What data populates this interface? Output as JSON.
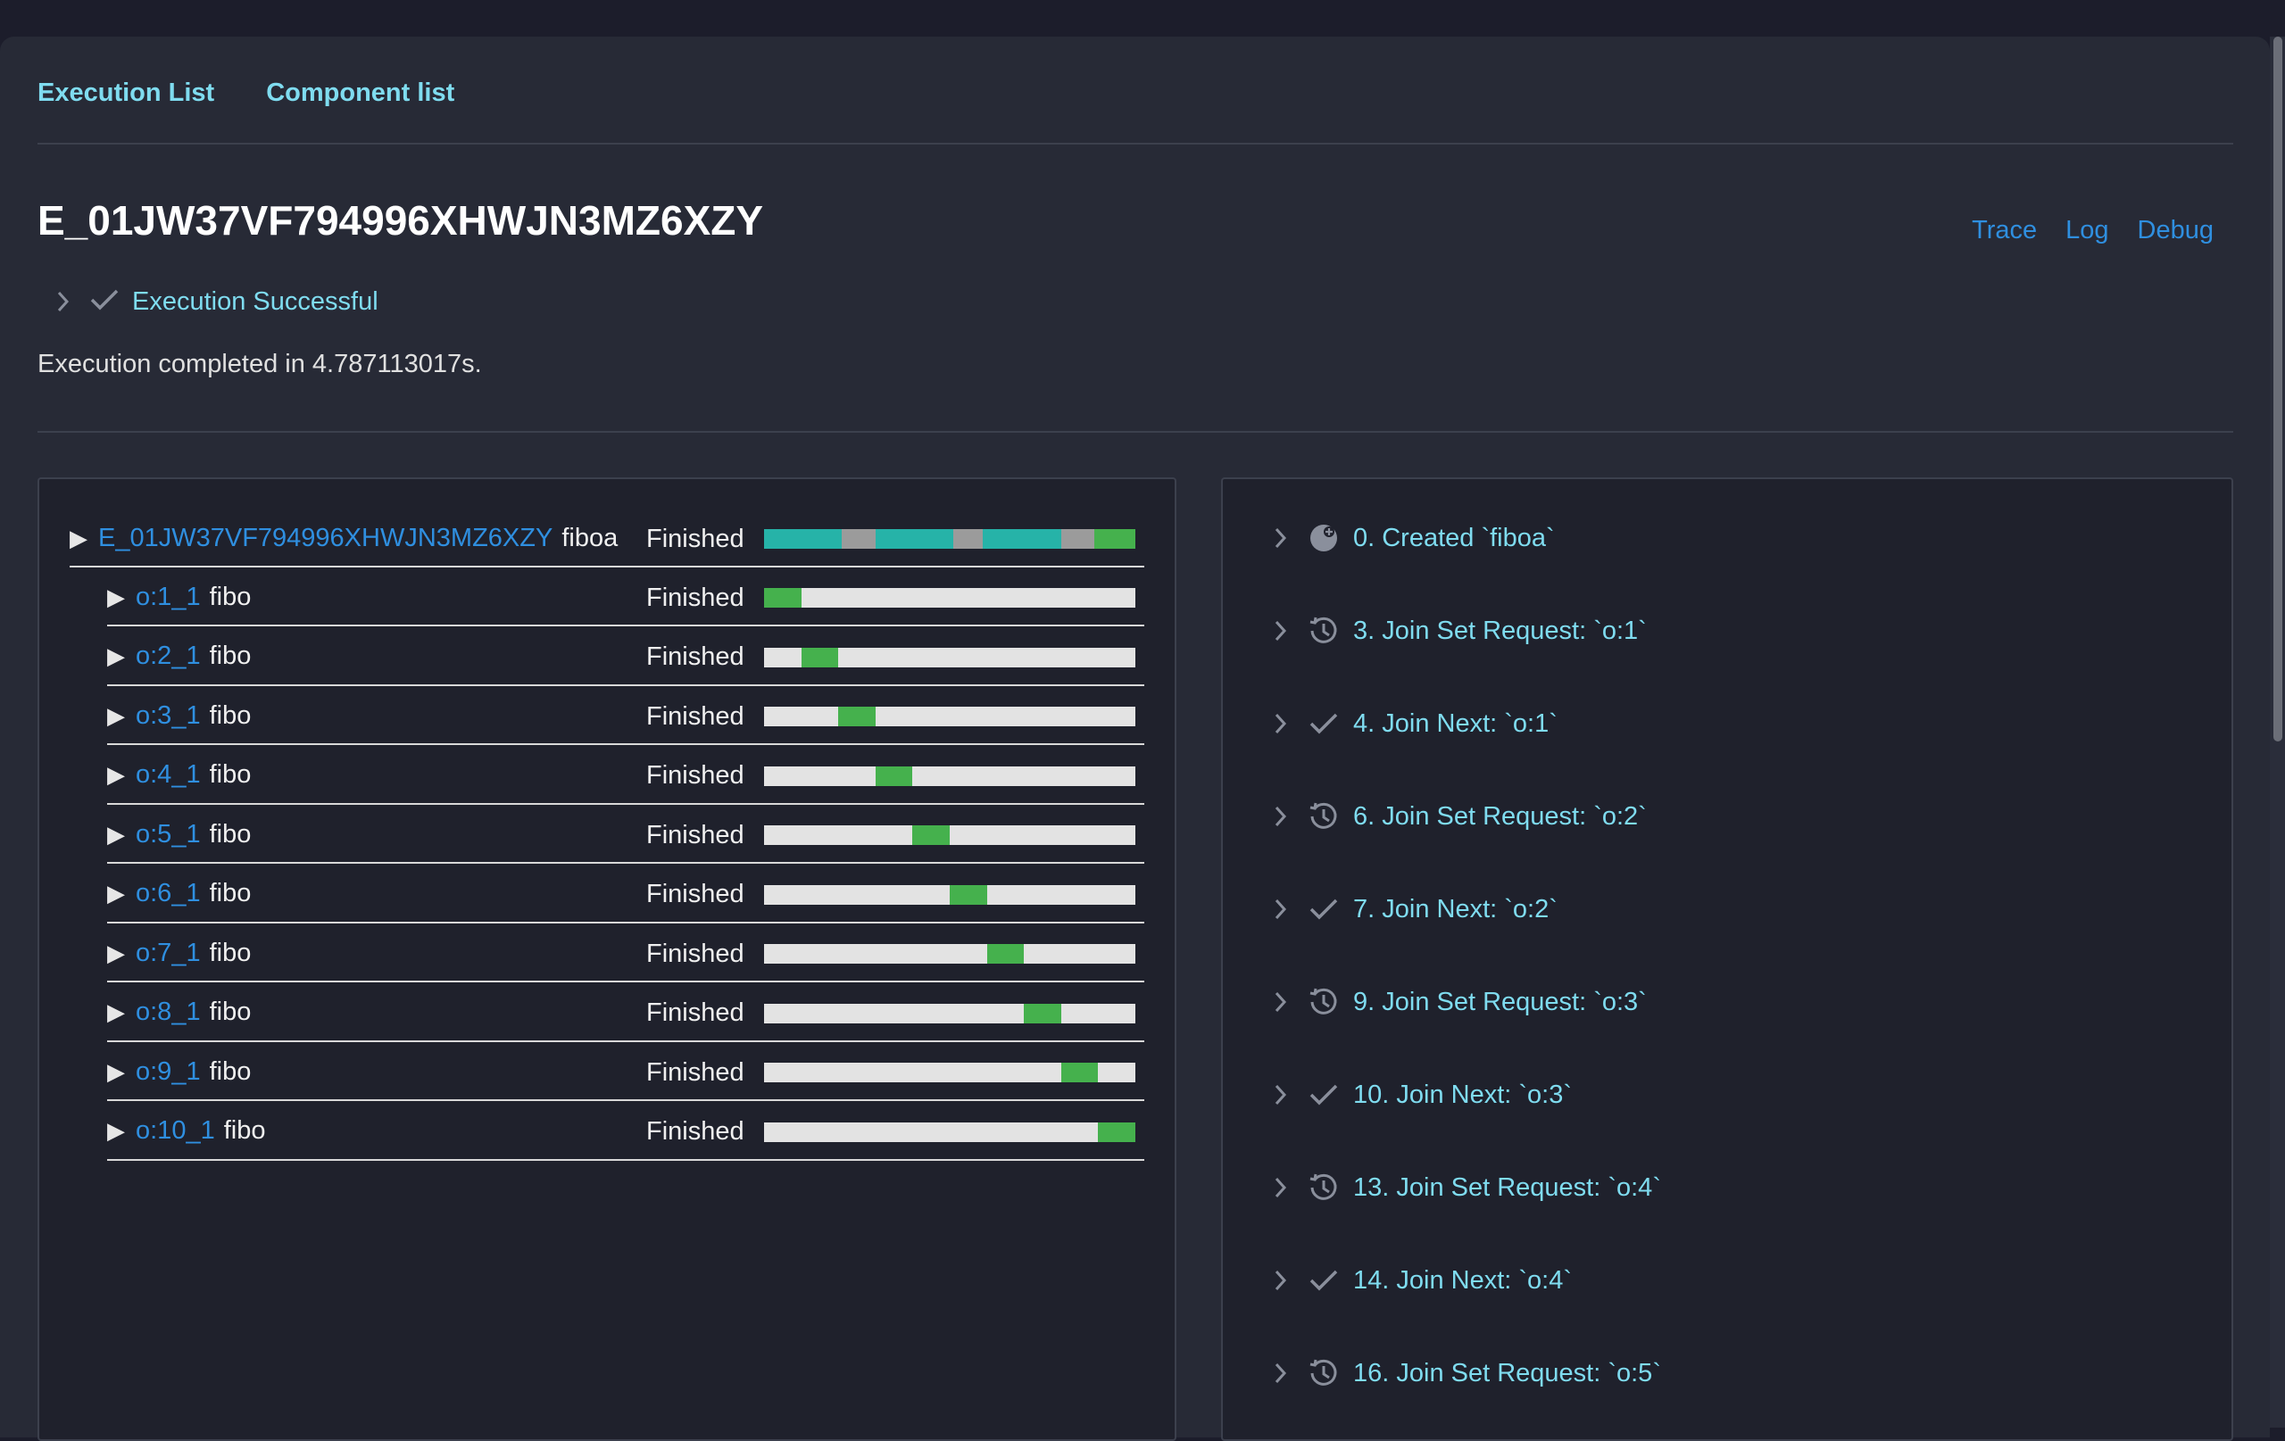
{
  "nav": {
    "execution_list": "Execution List",
    "component_list": "Component list"
  },
  "execution": {
    "id": "E_01JW37VF794996XHWJN3MZ6XZY",
    "status": "Execution Successful",
    "summary": "Execution completed in 4.787113017s."
  },
  "actions": {
    "trace": "Trace",
    "log": "Log",
    "debug": "Debug"
  },
  "colors": {
    "teal": "#26b3a8",
    "gray": "#9b9b9b",
    "green": "#45b14d",
    "track": "#e3e3e3",
    "link": "#2f8fe0",
    "accent": "#7fdcf0"
  },
  "tree": {
    "root": {
      "id": "E_01JW37VF794996XHWJN3MZ6XZY",
      "fn": "fiboa",
      "status": "Finished",
      "segments": [
        {
          "color": "teal",
          "frac": 0.21
        },
        {
          "color": "gray",
          "frac": 0.09
        },
        {
          "color": "teal",
          "frac": 0.21
        },
        {
          "color": "gray",
          "frac": 0.08
        },
        {
          "color": "teal",
          "frac": 0.21
        },
        {
          "color": "gray",
          "frac": 0.09
        },
        {
          "color": "green",
          "frac": 0.11
        }
      ]
    },
    "children": [
      {
        "id": "o:1_1",
        "fn": "fibo",
        "status": "Finished",
        "start": 0.0,
        "span": 0.1
      },
      {
        "id": "o:2_1",
        "fn": "fibo",
        "status": "Finished",
        "start": 0.1,
        "span": 0.1
      },
      {
        "id": "o:3_1",
        "fn": "fibo",
        "status": "Finished",
        "start": 0.2,
        "span": 0.1
      },
      {
        "id": "o:4_1",
        "fn": "fibo",
        "status": "Finished",
        "start": 0.3,
        "span": 0.1
      },
      {
        "id": "o:5_1",
        "fn": "fibo",
        "status": "Finished",
        "start": 0.4,
        "span": 0.1
      },
      {
        "id": "o:6_1",
        "fn": "fibo",
        "status": "Finished",
        "start": 0.5,
        "span": 0.1
      },
      {
        "id": "o:7_1",
        "fn": "fibo",
        "status": "Finished",
        "start": 0.6,
        "span": 0.1
      },
      {
        "id": "o:8_1",
        "fn": "fibo",
        "status": "Finished",
        "start": 0.7,
        "span": 0.1
      },
      {
        "id": "o:9_1",
        "fn": "fibo",
        "status": "Finished",
        "start": 0.8,
        "span": 0.1
      },
      {
        "id": "o:10_1",
        "fn": "fibo",
        "status": "Finished",
        "start": 0.9,
        "span": 0.1
      }
    ]
  },
  "events": [
    {
      "label": "0. Created `fiboa`",
      "icon": "created-icon"
    },
    {
      "label": "3. Join Set Request: `o:1`",
      "icon": "history-icon"
    },
    {
      "label": "4. Join Next: `o:1`",
      "icon": "check-icon"
    },
    {
      "label": "6. Join Set Request: `o:2`",
      "icon": "history-icon"
    },
    {
      "label": "7. Join Next: `o:2`",
      "icon": "check-icon"
    },
    {
      "label": "9. Join Set Request: `o:3`",
      "icon": "history-icon"
    },
    {
      "label": "10. Join Next: `o:3`",
      "icon": "check-icon"
    },
    {
      "label": "13. Join Set Request: `o:4`",
      "icon": "history-icon"
    },
    {
      "label": "14. Join Next: `o:4`",
      "icon": "check-icon"
    },
    {
      "label": "16. Join Set Request: `o:5`",
      "icon": "history-icon"
    }
  ]
}
